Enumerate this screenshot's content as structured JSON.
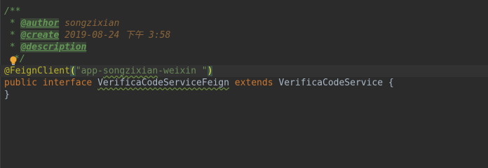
{
  "editor": {
    "comment_open": "/**",
    "comment_star": " * ",
    "author_tag": "@author",
    "author_value": " songzixian",
    "create_tag": "@create",
    "create_value": " 2019-08-24 下午 3:58",
    "description_tag": "@description",
    "comment_close": "*/",
    "annotation": "@FeignClient",
    "annotation_open": "(",
    "annotation_arg_q1": "\"app-",
    "annotation_arg_main": "songzixian",
    "annotation_arg_rest": "-weixin \"",
    "annotation_close": ")",
    "kw_public": "public",
    "kw_interface": "interface",
    "class_name": "VerificaCodeServiceFeign",
    "kw_extends": "extends",
    "super_name": "VerificaCodeService",
    "open_brace": "{",
    "close_brace": "}"
  },
  "icons": {
    "intention": "lightbulb-icon"
  },
  "colors": {
    "background": "#2b2b2b",
    "comment": "#629755",
    "keyword": "#cc7832",
    "annotation": "#bbb529",
    "string": "#6a8759",
    "text": "#a9b7c6"
  }
}
